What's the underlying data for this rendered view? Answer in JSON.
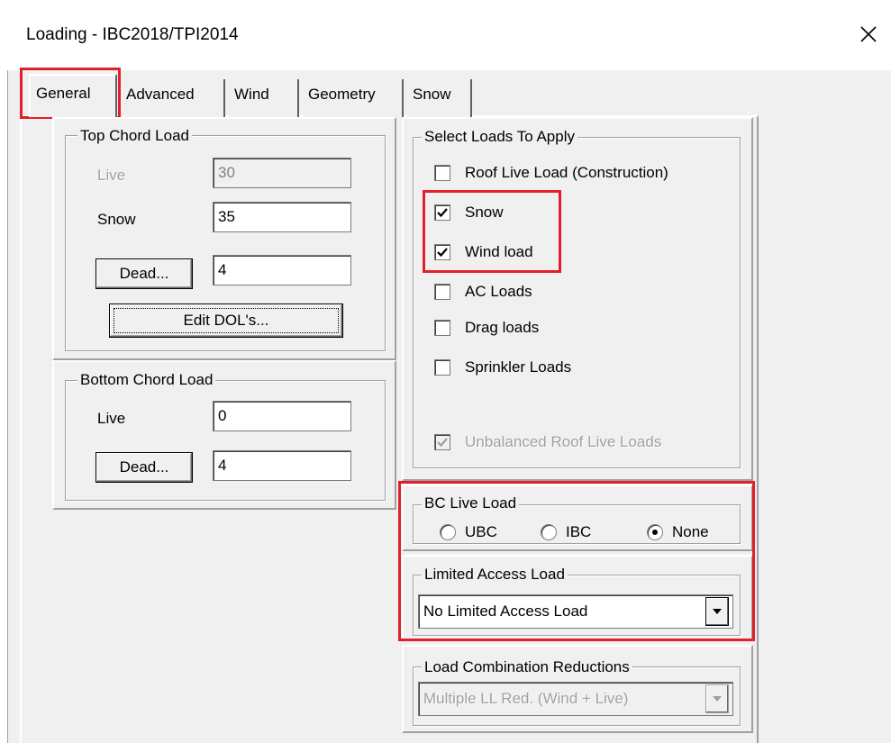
{
  "window": {
    "title": "Loading - IBC2018/TPI2014"
  },
  "tabs": [
    {
      "label": "General",
      "active": true
    },
    {
      "label": "Advanced",
      "active": false
    },
    {
      "label": "Wind",
      "active": false
    },
    {
      "label": "Geometry",
      "active": false
    },
    {
      "label": "Snow",
      "active": false
    }
  ],
  "top_chord": {
    "title": "Top Chord Load",
    "live_label": "Live",
    "live_value": "30",
    "snow_label": "Snow",
    "snow_value": "35",
    "dead_button": "Dead...",
    "dead_value": "4",
    "edit_dols_button": "Edit DOL's..."
  },
  "bottom_chord": {
    "title": "Bottom Chord Load",
    "live_label": "Live",
    "live_value": "0",
    "dead_button": "Dead...",
    "dead_value": "4"
  },
  "select_loads": {
    "title": "Select Loads To Apply",
    "items": [
      {
        "label": "Roof Live Load (Construction)",
        "checked": false
      },
      {
        "label": "Snow",
        "checked": true
      },
      {
        "label": "Wind load",
        "checked": true
      },
      {
        "label": "AC Loads",
        "checked": false
      },
      {
        "label": "Drag loads",
        "checked": false
      },
      {
        "label": "Sprinkler Loads",
        "checked": false
      }
    ],
    "unbalanced_label": "Unbalanced Roof Live Loads"
  },
  "bc_live": {
    "title": "BC Live Load",
    "options": [
      "UBC",
      "IBC",
      "None"
    ],
    "selected": "None"
  },
  "limited_access": {
    "title": "Limited Access Load",
    "value": "No Limited Access Load"
  },
  "load_combination": {
    "title": "Load Combination Reductions",
    "value": "Multiple LL Red. (Wind + Live)"
  },
  "colors": {
    "highlight": "#e0202c",
    "face": "#f0f0f0"
  }
}
